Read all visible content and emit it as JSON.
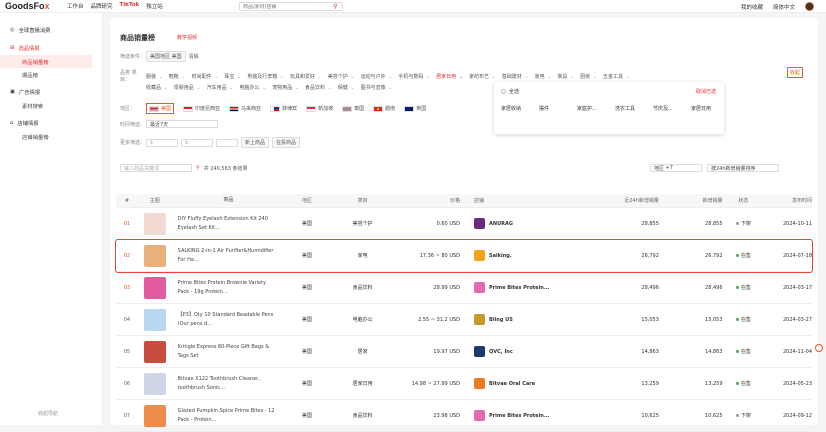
{
  "brand": {
    "logo_main": "GoodsFo",
    "logo_x": "x"
  },
  "topnav": [
    "工作台",
    "品牌研究",
    "TikTok",
    "独立站"
  ],
  "search": {
    "placeholder": "商品/素材/店铺"
  },
  "topright": {
    "collect": "我的收藏",
    "lang": "简体中文"
  },
  "sidebar": {
    "groups": [
      {
        "title": "全球直播消费",
        "children": []
      },
      {
        "title": "选品情报",
        "children": [
          "商品销量榜",
          "爆品榜"
        ]
      },
      {
        "title": "广告情报",
        "children": [
          "素材搜索"
        ]
      },
      {
        "title": "店铺情报",
        "children": [
          "店铺销量榜"
        ]
      }
    ],
    "footer": "收起导航"
  },
  "page": {
    "title": "商品销量榜",
    "tutorial": "教学视频",
    "condition_label": "筛选条件：",
    "condition_tags": [
      "美国地区 美国",
      "清除"
    ],
    "category_label": "品类 类目：",
    "categories_row1": [
      "服装",
      "鞋靴",
      "时尚配件",
      "珠宝",
      "男装及行李箱",
      "玩具和爱好",
      "美容个护",
      "运动与户外",
      "手机与数码",
      "居家日用",
      "家纺布艺",
      "基础建材",
      "家电",
      "家具",
      "厨房",
      "五金工具"
    ],
    "categories_row2": [
      "收藏品",
      "母婴用品",
      "汽车用品",
      "电脑办公",
      "宠物用品",
      "食品饮料",
      "保健",
      "图书与音像"
    ],
    "collapse": "收起",
    "popover": {
      "select_all": "全选",
      "cancel": "取消已选",
      "items": [
        "家居收纳",
        "摆件",
        "家庭护...",
        "洗衣工具",
        "节庆及...",
        "家居日用"
      ]
    },
    "region_label": "地区：",
    "regions": [
      "美国",
      "印度尼西亚",
      "马来西亚",
      "菲律宾",
      "新加坡",
      "泰国",
      "越南",
      "英国"
    ],
    "time_label": "时间筛选：",
    "time_value": "最近7天",
    "more_label": "更多筛选：",
    "price_min": "$",
    "price_max": "$",
    "new_goods": "新上商品",
    "store_goods": "在投商品",
    "search_placeholder": "输入商品关键词",
    "result": "共 240,563 条结果",
    "region_select": "地区",
    "region_select_val": "+7",
    "sort": "按24h新增销量排序"
  },
  "table": {
    "headers": [
      "#",
      "主图",
      "商品",
      "地区",
      "类目",
      "价格",
      "店铺",
      "近24h新增销量",
      "新增销量",
      "状态",
      "发布时间"
    ],
    "rows": [
      {
        "rank": "01",
        "name": "DIY Fluffy Eyelash Extension Kit 240 Eyelash Set Kit...",
        "region": "美国",
        "cat": "美容个护",
        "price": "0.60 USD",
        "store": "ANURAG",
        "s24": "28,855",
        "sales": "28,855",
        "status": "下架",
        "date": "2024-10-11",
        "thumb": "#f2d9d2",
        "storec": "#6b2d7b",
        "statusc": "#999"
      },
      {
        "rank": "02",
        "name": "SALKING 2-in-1 Air Purifier&Humidifier For Ha...",
        "region": "美国",
        "cat": "家电",
        "price": "17.36 ~ 80 USD",
        "store": "Salking.",
        "s24": "26,792",
        "sales": "26,792",
        "status": "在售",
        "date": "2024-07-18",
        "thumb": "#e9b17a",
        "storec": "#f4a21c",
        "statusc": "#3bb54a"
      },
      {
        "rank": "03",
        "name": "Prime Bites Protein Brownie Variety Pack - 19g Protein...",
        "region": "美国",
        "cat": "食品饮料",
        "price": "28.99 USD",
        "store": "Prime Bites Protein...",
        "s24": "28,496",
        "sales": "28,496",
        "status": "在售",
        "date": "2024-03-17",
        "thumb": "#e25a9f",
        "storec": "#e46ab0",
        "statusc": "#3bb54a"
      },
      {
        "rank": "04",
        "name": "【P3】Qty 10 Standard Beadable Pens (Our pens d...",
        "region": "美国",
        "cat": "电脑办公",
        "price": "2.55 ~ 31.2 USD",
        "store": "Bling US",
        "s24": "15,053",
        "sales": "15,053",
        "status": "在售",
        "date": "2024-03-27",
        "thumb": "#b9d8ef",
        "storec": "#c49a2b",
        "statusc": "#3bb54a"
      },
      {
        "rank": "05",
        "name": "Kringle Express 80-Piece Gift Bags & Tags Set",
        "region": "美国",
        "cat": "居家",
        "price": "19.97 USD",
        "store": "QVC, Inc",
        "s24": "14,863",
        "sales": "14,863",
        "status": "在售",
        "date": "2024-11-04",
        "thumb": "#c94d3e",
        "storec": "#1a3a6a",
        "statusc": "#3bb54a"
      },
      {
        "rank": "06",
        "name": "Bitvae X122 Toothbrush Cleaner, toothbrush Sonic...",
        "region": "美国",
        "cat": "居家日用",
        "price": "14.98 ~ 27.99 USD",
        "store": "Bitvae Oral Care",
        "s24": "13,259",
        "sales": "13,259",
        "status": "在售",
        "date": "2024-05-23",
        "thumb": "#cfd7e6",
        "storec": "#ee7a22",
        "statusc": "#3bb54a"
      },
      {
        "rank": "07",
        "name": "Glazed Pumpkin Spice Prime Bites - 12 Pack - Protein...",
        "region": "美国",
        "cat": "食品饮料",
        "price": "23.98 USD",
        "store": "Prime Bites Protein...",
        "s24": "10,625",
        "sales": "10,625",
        "status": "下架",
        "date": "2024-09-12",
        "thumb": "#ee8c4b",
        "storec": "#e46ab0",
        "statusc": "#999"
      }
    ]
  }
}
